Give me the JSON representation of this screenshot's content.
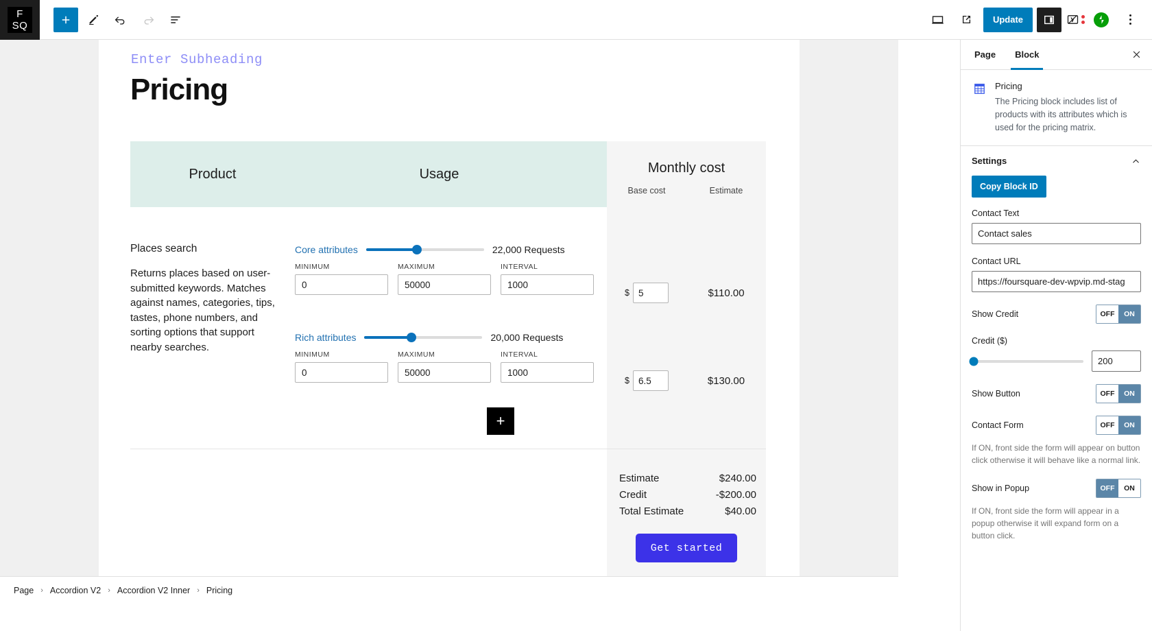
{
  "topbar": {
    "logo_line1": "F",
    "logo_line2": "SQ",
    "add_block_icon": "plus-icon",
    "tools_icon": "pencil-icon",
    "undo_icon": "undo-arrow-icon",
    "redo_icon": "redo-arrow-icon",
    "list_view_icon": "list-view-icon",
    "preview_icon": "desktop-preview-icon",
    "view_icon": "external-link-icon",
    "update_label": "Update",
    "settings_icon": "sidebar-panel-icon",
    "yoast_icon": "yoast-seo-icon",
    "jetpack_icon": "jetpack-icon",
    "options_icon": "kebab-menu-icon"
  },
  "canvas": {
    "subheading_placeholder": "Enter Subheading",
    "title": "Pricing",
    "table": {
      "head_product": "Product",
      "head_usage": "Usage",
      "head_monthly": "Monthly cost",
      "head_base_cost": "Base cost",
      "head_estimate": "Estimate",
      "product": {
        "name": "Places search",
        "description": "Returns places based on user-submitted keywords. Matches against names, categories, tips, tastes, phone numbers, and sorting options that support nearby searches."
      },
      "attribute_rows": [
        {
          "label": "Core attributes",
          "slider_percent": 43,
          "count": "22,000 Requests",
          "minimum_label": "MINIMUM",
          "minimum_value": "0",
          "maximum_label": "MAXIMUM",
          "maximum_value": "50000",
          "interval_label": "INTERVAL",
          "interval_value": "1000",
          "base_cost_symbol": "$",
          "base_cost_value": "5",
          "estimate": "$110.00"
        },
        {
          "label": "Rich attributes",
          "slider_percent": 40,
          "count": "20,000 Requests",
          "minimum_label": "MINIMUM",
          "minimum_value": "0",
          "maximum_label": "MAXIMUM",
          "maximum_value": "50000",
          "interval_label": "INTERVAL",
          "interval_value": "1000",
          "base_cost_symbol": "$",
          "base_cost_value": "6.5",
          "estimate": "$130.00"
        }
      ],
      "add_row_label": "+",
      "totals": [
        {
          "label": "Estimate",
          "value": "$240.00"
        },
        {
          "label": "Credit",
          "value": "-$200.00"
        },
        {
          "label": "Total Estimate",
          "value": "$40.00"
        }
      ],
      "cta_label": "Get started"
    }
  },
  "breadcrumb": {
    "separator": "›",
    "items": [
      "Page",
      "Accordion V2",
      "Accordion V2 Inner",
      "Pricing"
    ]
  },
  "inspector": {
    "tabs": [
      {
        "label": "Page",
        "active": false
      },
      {
        "label": "Block",
        "active": true
      }
    ],
    "close_icon": "close-icon",
    "block": {
      "icon": "pricing-table-icon",
      "title": "Pricing",
      "description": "The Pricing block includes list of products with its attributes which is used for the pricing matrix."
    },
    "settings": {
      "heading": "Settings",
      "collapse_icon": "chevron-up-icon",
      "copy_block_id_label": "Copy Block ID",
      "contact_text_label": "Contact Text",
      "contact_text_value": "Contact sales",
      "contact_url_label": "Contact URL",
      "contact_url_value": "https://foursquare-dev-wpvip.md-stag",
      "show_credit_label": "Show Credit",
      "show_credit_off": "OFF",
      "show_credit_on": "ON",
      "show_credit_state": "ON",
      "credit_label": "Credit ($)",
      "credit_slider_percent": 2,
      "credit_value": "200",
      "show_button_label": "Show Button",
      "show_button_off": "OFF",
      "show_button_on": "ON",
      "show_button_state": "ON",
      "contact_form_label": "Contact Form",
      "contact_form_off": "OFF",
      "contact_form_on": "ON",
      "contact_form_state": "ON",
      "contact_form_help": "If ON, front side the form will appear on button click otherwise it will behave like a normal link.",
      "show_popup_label": "Show in Popup",
      "show_popup_off": "OFF",
      "show_popup_on": "ON",
      "show_popup_state": "OFF",
      "show_popup_help": "If ON, front side the form will appear in a popup otherwise it will expand form on a button click."
    }
  },
  "colors": {
    "accent_blue": "#007cba",
    "cta_indigo": "#3c32e8",
    "table_head_teal": "#ddeeea",
    "slider_blue": "#0b72bb",
    "subheading_purple": "#8e8ef7"
  }
}
